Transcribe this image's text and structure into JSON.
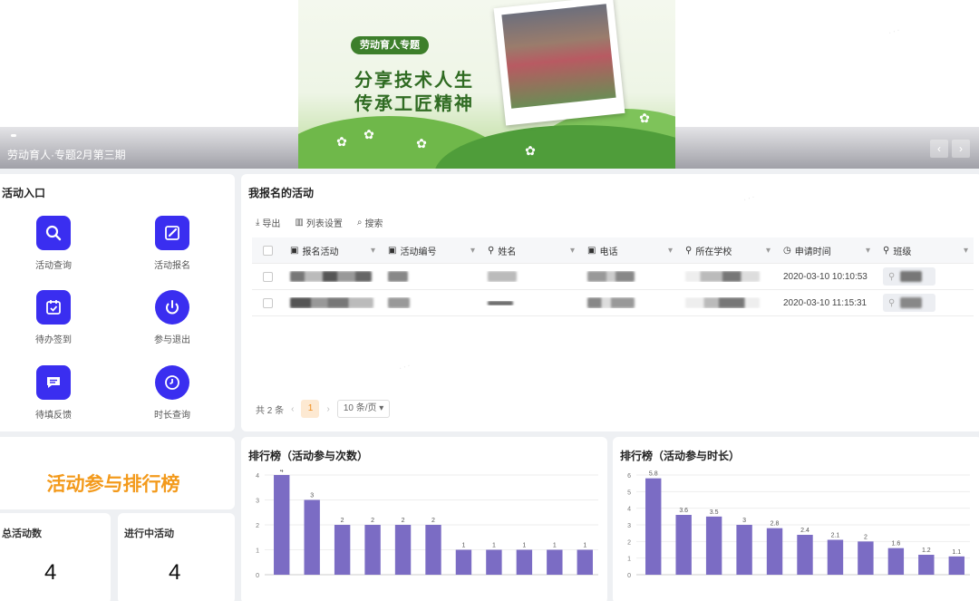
{
  "banner": {
    "tag": "劳动育人专题",
    "line1": "分享技术人生",
    "line2": "传承工匠精神",
    "caption": "劳动育人·专题2月第三期",
    "prev_icon": "chevron-left-icon",
    "next_icon": "chevron-right-icon"
  },
  "entry": {
    "title": "活动入口",
    "items": [
      {
        "label": "活动查询",
        "icon": "search-icon"
      },
      {
        "label": "活动报名",
        "icon": "edit-icon"
      },
      {
        "label": "待办签到",
        "icon": "calendar-check-icon"
      },
      {
        "label": "参与退出",
        "icon": "power-icon"
      },
      {
        "label": "待填反馈",
        "icon": "chat-icon"
      },
      {
        "label": "时长查询",
        "icon": "clock-icon"
      }
    ]
  },
  "table_panel": {
    "title": "我报名的活动",
    "toolbar": [
      "导出",
      "列表设置",
      "搜索"
    ],
    "columns": [
      "报名活动",
      "活动编号",
      "姓名",
      "电话",
      "所在学校",
      "申请时间",
      "班级"
    ],
    "rows": [
      {
        "time": "2020-03-10 10:10:53"
      },
      {
        "time": "2020-03-10 11:15:31"
      }
    ],
    "pager": {
      "total": "共 2 条",
      "current": "1",
      "size": "10 条/页"
    }
  },
  "ranking": {
    "title": "活动参与排行榜",
    "stats": [
      {
        "label": "总活动数",
        "value": "4"
      },
      {
        "label": "进行中活动",
        "value": "4"
      }
    ]
  },
  "chart_data": [
    {
      "type": "bar",
      "title": "排行榜（活动参与次数）",
      "ylim": [
        0,
        4
      ],
      "yticks": [
        "0",
        "1",
        "2",
        "3",
        "4"
      ],
      "values": [
        4,
        3,
        2,
        2,
        2,
        2,
        1,
        1,
        1,
        1,
        1
      ],
      "bar_color": "#7b6cc4"
    },
    {
      "type": "bar",
      "title": "排行榜（活动参与时长）",
      "ylim": [
        0,
        6
      ],
      "yticks": [
        "0",
        "1",
        "2",
        "3",
        "4",
        "5",
        "6"
      ],
      "values": [
        5.8,
        3.6,
        3.5,
        3.0,
        2.8,
        2.4,
        2.1,
        2.0,
        1.6,
        1.2,
        1.1
      ],
      "bar_color": "#7b6cc4"
    }
  ]
}
